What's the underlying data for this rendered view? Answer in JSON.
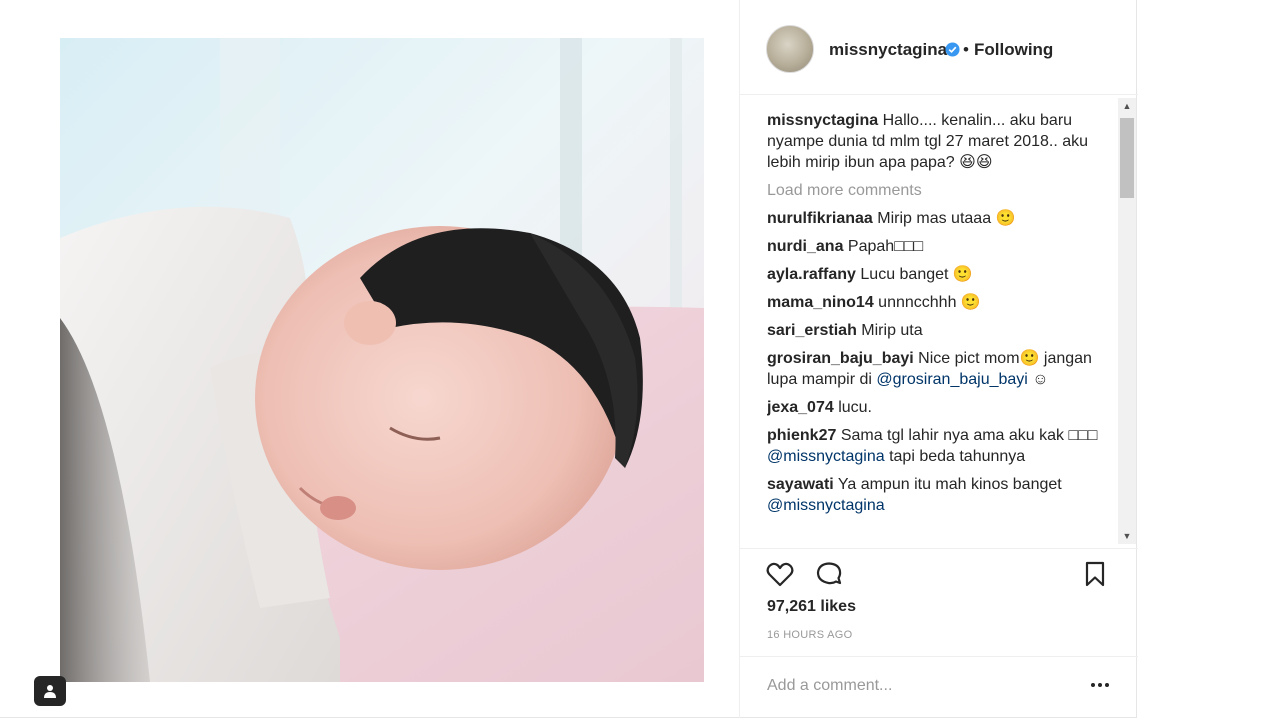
{
  "post": {
    "username": "missnyctagina",
    "separator": "•",
    "follow_state": "Following",
    "verified": true,
    "caption": {
      "username": "missnyctagina",
      "text": "Hallo.... kenalin... aku baru nyampe dunia td mlm tgl 27 maret 2018.. aku lebih mirip ibun apa papa? 😆😆"
    },
    "load_more": "Load more comments",
    "comments": [
      {
        "user": "nurulfikrianaa",
        "text": "Mirip mas utaaa 🙂"
      },
      {
        "user": "nurdi_ana",
        "text": "Papah□□□"
      },
      {
        "user": "ayla.raffany",
        "text": "Lucu banget 🙂"
      },
      {
        "user": "mama_nino14",
        "text": "unnncchhh 🙂"
      },
      {
        "user": "sari_erstiah",
        "text": "Mirip uta"
      },
      {
        "user": "grosiran_baju_bayi",
        "text": "Nice pict mom🙂 jangan lupa mampir di",
        "mention": "@grosiran_baju_bayi",
        "after": " ☺"
      },
      {
        "user": "jexa_074",
        "text": "lucu."
      },
      {
        "user": "phienk27",
        "text": "Sama tgl lahir nya ama aku kak □□□",
        "mention": "@missnyctagina",
        "after": " tapi beda tahunnya"
      },
      {
        "user": "sayawati",
        "text": "Ya ampun itu mah kinos banget",
        "mention": "@missnyctagina",
        "after": ""
      }
    ],
    "likes": "97,261 likes",
    "time_ago": "16 HOURS AGO",
    "add_comment_placeholder": "Add a comment...",
    "icons": {
      "like": "heart-outline-icon",
      "comment": "speech-bubble-icon",
      "save": "bookmark-icon",
      "more": "more-options-icon",
      "user_tag": "user-tag-icon",
      "verified": "verified-badge-icon"
    },
    "colors": {
      "verified": "#3897f0",
      "muted": "#999999",
      "text": "#262626",
      "mention": "#003569"
    }
  }
}
